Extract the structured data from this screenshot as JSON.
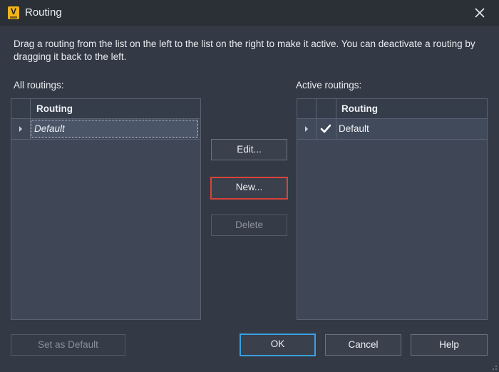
{
  "window": {
    "title": "Routing",
    "app_icon_letter": "V"
  },
  "instructions": "Drag a routing from the list on the left to the list on the right to make it active. You can deactivate a routing by dragging it back to the left.",
  "all_routings": {
    "label": "All routings:",
    "column_header": "Routing",
    "rows": [
      {
        "name": "Default"
      }
    ]
  },
  "active_routings": {
    "label": "Active routings:",
    "column_header": "Routing",
    "rows": [
      {
        "name": "Default",
        "active": true
      }
    ]
  },
  "buttons": {
    "edit": "Edit...",
    "new": "New...",
    "delete": "Delete",
    "set_default": "Set as Default",
    "ok": "OK",
    "cancel": "Cancel",
    "help": "Help"
  },
  "icons": {
    "close": "close-icon",
    "expand": "expand-arrow-icon",
    "check": "checkmark-icon"
  }
}
